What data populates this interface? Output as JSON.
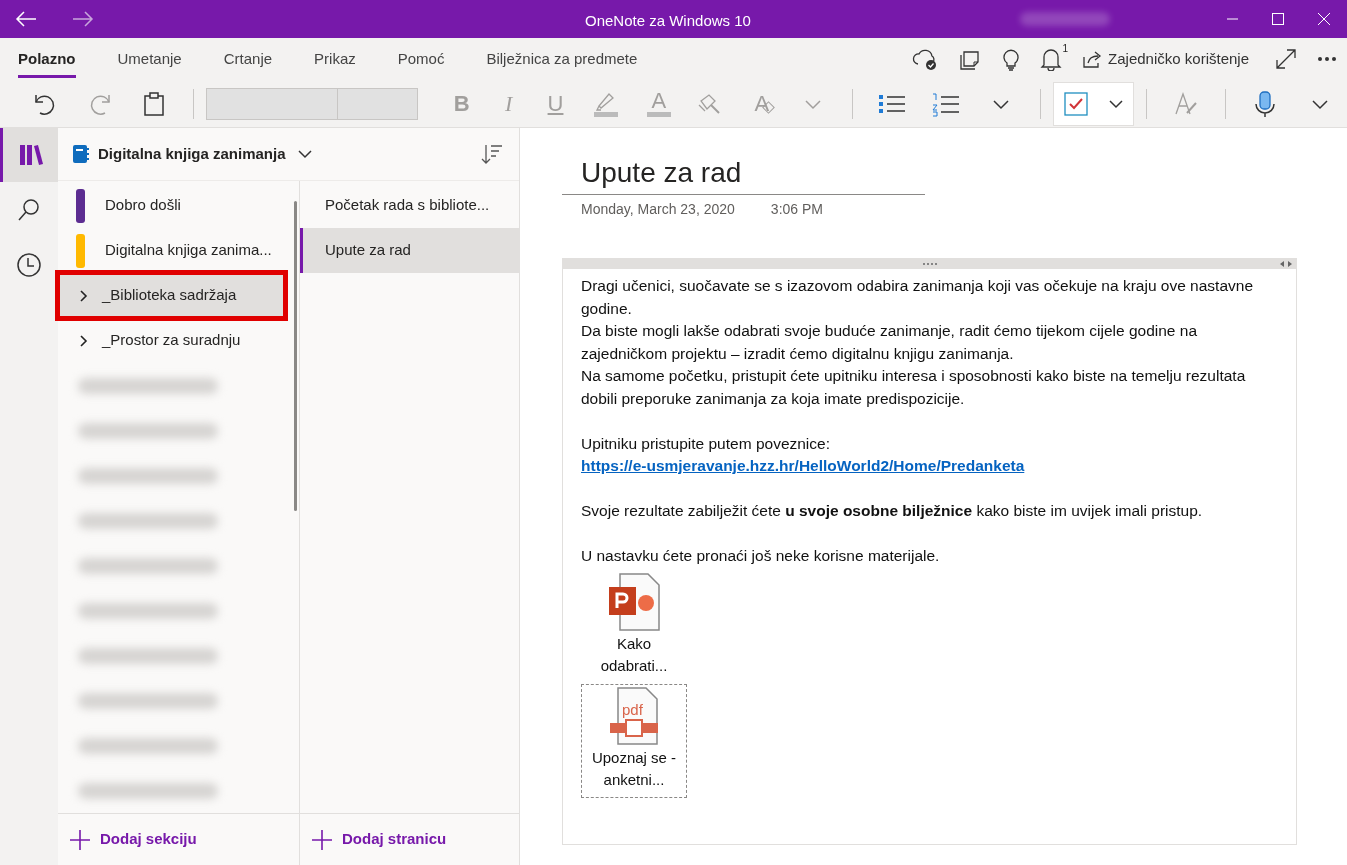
{
  "window": {
    "title": "OneNote za Windows 10",
    "account": {
      "kind": "blurred"
    },
    "forward_disabled": true
  },
  "tabs": [
    {
      "label": "Polazno",
      "selected": true
    },
    {
      "label": "Umetanje",
      "selected": false
    },
    {
      "label": "Crtanje",
      "selected": false
    },
    {
      "label": "Prikaz",
      "selected": false
    },
    {
      "label": "Pomoć",
      "selected": false
    },
    {
      "label": "Bilježnica za predmete",
      "selected": false
    }
  ],
  "tab_actions": {
    "notification_badge": "1",
    "share_label": "Zajedničko korištenje"
  },
  "toolbar": [
    {
      "kind": "undo",
      "disabled": false
    },
    {
      "kind": "redo",
      "disabled": true
    },
    {
      "kind": "clipboard",
      "disabled": false
    },
    {
      "kind": "separator"
    },
    {
      "kind": "font_fields"
    },
    {
      "kind": "bold",
      "text": "B",
      "disabled": true
    },
    {
      "kind": "italic",
      "text": "I",
      "disabled": true
    },
    {
      "kind": "underline",
      "text": "U",
      "disabled": true
    },
    {
      "kind": "highlighter",
      "disabled": true
    },
    {
      "kind": "font_color",
      "text": "A",
      "disabled": true
    },
    {
      "kind": "brush",
      "disabled": true
    },
    {
      "kind": "clear_format",
      "text": "A",
      "disabled": true
    },
    {
      "kind": "chevron",
      "disabled": true
    },
    {
      "kind": "separator"
    },
    {
      "kind": "bullets",
      "disabled": false
    },
    {
      "kind": "numbering",
      "disabled": false
    },
    {
      "kind": "chevron",
      "disabled": false
    },
    {
      "kind": "separator"
    },
    {
      "kind": "todo_tag",
      "disabled": false
    },
    {
      "kind": "separator"
    },
    {
      "kind": "styles",
      "disabled": true
    },
    {
      "kind": "separator"
    },
    {
      "kind": "dictate",
      "disabled": false
    },
    {
      "kind": "chevron",
      "disabled": false
    }
  ],
  "notebook": {
    "name": "Digitalna knjiga zanimanja"
  },
  "sections": [
    {
      "kind": "section",
      "label": "Dobro došli",
      "color": "#5c2d91",
      "selected": false,
      "annotated": false
    },
    {
      "kind": "section",
      "label": "Digitalna knjiga zanima...",
      "color": "#ffb900",
      "selected": false,
      "annotated": false
    },
    {
      "kind": "group",
      "label": "_Biblioteka sadržaja",
      "expanded": false,
      "selected": true,
      "annotated": true
    },
    {
      "kind": "group",
      "label": "_Prostor za suradnju",
      "expanded": false,
      "selected": false,
      "annotated": false
    },
    {
      "kind": "blurred"
    },
    {
      "kind": "blurred"
    },
    {
      "kind": "blurred"
    },
    {
      "kind": "blurred"
    },
    {
      "kind": "blurred"
    },
    {
      "kind": "blurred"
    },
    {
      "kind": "blurred"
    },
    {
      "kind": "blurred"
    },
    {
      "kind": "blurred"
    },
    {
      "kind": "blurred"
    }
  ],
  "add_section": "Dodaj sekciju",
  "pages": [
    {
      "label": "Početak rada s bibliote...",
      "selected": false
    },
    {
      "label": "Upute za rad",
      "selected": true
    }
  ],
  "add_page": "Dodaj stranicu",
  "page": {
    "title": "Upute za rad",
    "date": "Monday, March 23, 2020",
    "time": "3:06 PM",
    "blocks": [
      {
        "kind": "text",
        "text": "Dragi učenici, suočavate se s izazovom odabira zanimanja koji vas očekuje na kraju ove nastavne godine."
      },
      {
        "kind": "text",
        "text": "Da biste mogli lakše odabrati svoje buduće zanimanje, radit ćemo tijekom cijele godine na zajedničkom projektu – izradit ćemo digitalnu knjigu zanimanja."
      },
      {
        "kind": "text",
        "text": "Na samome početku, pristupit ćete upitniku interesa i sposobnosti kako biste na temelju rezultata dobili preporuke zanimanja za koja imate predispozicije."
      },
      {
        "kind": "gap"
      },
      {
        "kind": "link",
        "text": "Upitniku pristupite putem poveznice:",
        "link": "https://e-usmjeravanje.hzz.hr/HelloWorld2/Home/Predanketa"
      },
      {
        "kind": "gap"
      },
      {
        "kind": "text",
        "text": "Svoje rezultate zabilježit ćete **u svoje osobne bilježnice** kako biste im uvijek imali pristup."
      },
      {
        "kind": "gap"
      },
      {
        "kind": "text",
        "text": "U nastavku ćete pronaći još neke korisne materijale."
      }
    ],
    "attachments": [
      {
        "kind": "pptx",
        "label": "Kako odabrati...",
        "selected": false
      },
      {
        "kind": "pdf",
        "label": "Upoznaj se - anketni...",
        "selected": true
      }
    ]
  }
}
